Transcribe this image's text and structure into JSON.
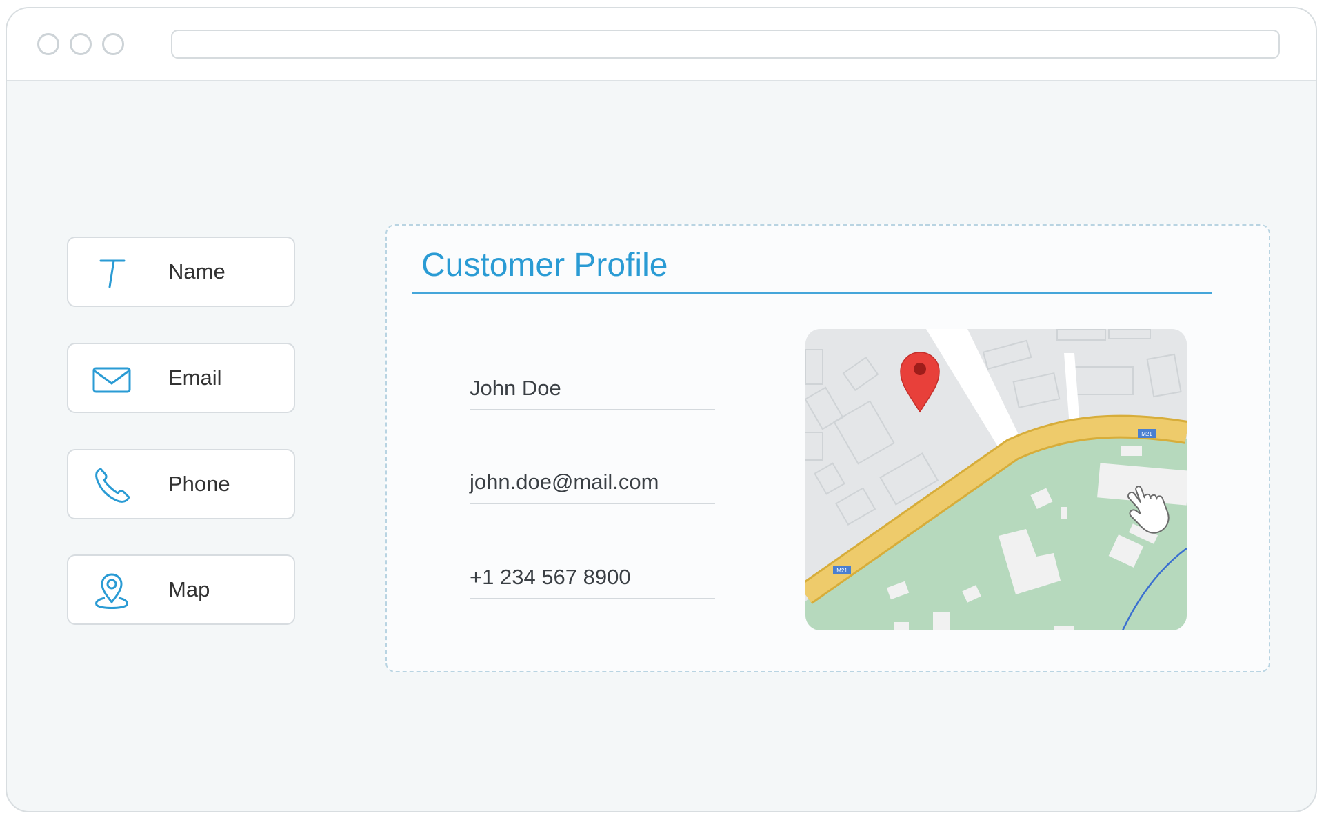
{
  "sidebar": {
    "items": [
      {
        "label": "Name",
        "icon": "text-t-icon"
      },
      {
        "label": "Email",
        "icon": "envelope-icon"
      },
      {
        "label": "Phone",
        "icon": "phone-icon"
      },
      {
        "label": "Map",
        "icon": "map-pin-icon"
      }
    ]
  },
  "profile": {
    "title": "Customer Profile",
    "name": "John Doe",
    "email": "john.doe@mail.com",
    "phone": "+1 234 567 8900"
  },
  "map": {
    "road_labels": [
      "M21",
      "M21"
    ]
  },
  "colors": {
    "accent": "#2a9bd4",
    "pin": "#e8403a",
    "road": "#eecb6b",
    "park": "#b6d9bd"
  }
}
